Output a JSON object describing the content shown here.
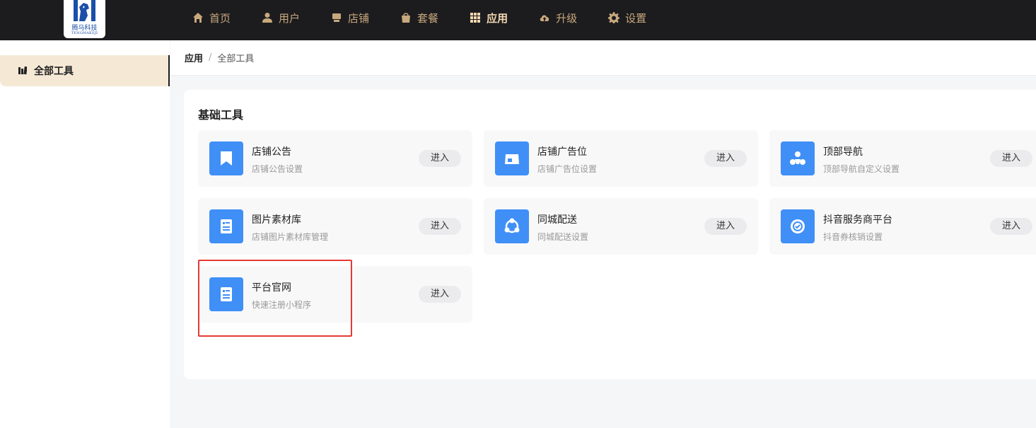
{
  "logo": {
    "text_cn": "腾马科技",
    "text_en": "TENGMAKEJI"
  },
  "nav": [
    {
      "label": "首页",
      "icon": "home-icon"
    },
    {
      "label": "用户",
      "icon": "user-icon"
    },
    {
      "label": "店铺",
      "icon": "store-icon"
    },
    {
      "label": "套餐",
      "icon": "bag-icon"
    },
    {
      "label": "应用",
      "icon": "grid-icon",
      "active": true
    },
    {
      "label": "升级",
      "icon": "cloud-upload-icon"
    },
    {
      "label": "设置",
      "icon": "gear-icon"
    }
  ],
  "sidebar": {
    "items": [
      {
        "label": "全部工具",
        "icon": "tools-icon",
        "active": true
      }
    ]
  },
  "breadcrumb": {
    "main": "应用",
    "separator": "/",
    "sub": "全部工具"
  },
  "section": {
    "title": "基础工具"
  },
  "enter_label": "进入",
  "tools": [
    {
      "title": "店铺公告",
      "desc": "店铺公告设置",
      "icon": "bookmark-icon"
    },
    {
      "title": "店铺广告位",
      "desc": "店铺广告位设置",
      "icon": "billboard-icon"
    },
    {
      "title": "顶部导航",
      "desc": "顶部导航自定义设置",
      "icon": "navigation-icon"
    },
    {
      "title": "图片素材库",
      "desc": "店铺图片素材库管理",
      "icon": "image-library-icon"
    },
    {
      "title": "同城配送",
      "desc": "同城配送设置",
      "icon": "delivery-icon"
    },
    {
      "title": "抖音服务商平台",
      "desc": "抖音券核销设置",
      "icon": "douyin-service-icon"
    },
    {
      "title": "平台官网",
      "desc": "快速注册小程序",
      "icon": "website-icon"
    }
  ],
  "colors": {
    "topbar": "#1c1c1e",
    "nav_text": "#c8a87d",
    "nav_active": "#f3d8b1",
    "icon_bg": "#3f8ff7",
    "highlight": "#e53935",
    "sidebar_active": "#f5e9d6"
  }
}
